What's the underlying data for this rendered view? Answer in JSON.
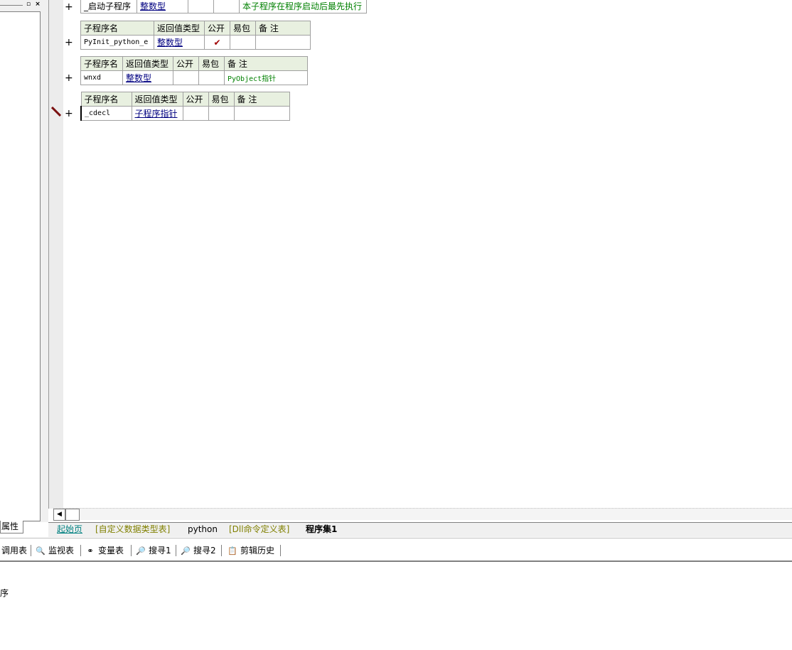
{
  "left_panel": {
    "tab_label": "属性",
    "pin_glyph": "▫",
    "close_glyph": "×"
  },
  "rows": [
    {
      "headers": null,
      "cells": [
        "_启动子程序",
        "整数型",
        "",
        "",
        "本子程序在程序启动后最先执行"
      ]
    },
    {
      "headers": [
        "子程序名",
        "返回值类型",
        "公开",
        "易包",
        "备 注"
      ],
      "cells": [
        "PyInit_python_e",
        "整数型",
        "✔",
        "",
        ""
      ]
    },
    {
      "headers": [
        "子程序名",
        "返回值类型",
        "公开",
        "易包",
        "备 注"
      ],
      "cells": [
        "wnxd",
        "整数型",
        "",
        "",
        "PyObject指针"
      ]
    },
    {
      "headers": [
        "子程序名",
        "返回值类型",
        "公开",
        "易包",
        "备 注"
      ],
      "cells": [
        "_cdecl",
        "子程序指针",
        "",
        "",
        ""
      ]
    }
  ],
  "plus_glyph": "+",
  "tabs": [
    "起始页",
    "[自定义数据类型表]",
    "python",
    "[Dll命令定义表]",
    "程序集1"
  ],
  "toolbar": [
    {
      "label": "调用表",
      "icon": "call-table-icon",
      "glyph": ""
    },
    {
      "label": "监视表",
      "icon": "magnifier-icon",
      "glyph": "🔍"
    },
    {
      "label": "变量表",
      "icon": "variables-icon",
      "glyph": "⚭"
    },
    {
      "label": "搜寻1",
      "icon": "search1-icon",
      "glyph": "🔎"
    },
    {
      "label": "搜寻2",
      "icon": "search2-icon",
      "glyph": "🔎"
    },
    {
      "label": "剪辑历史",
      "icon": "clip-history-icon",
      "glyph": "📋"
    }
  ],
  "output_text": "序",
  "colors": {
    "keyword_blue": "#000080",
    "comment_green": "#008000",
    "header_bg": "#e8f0e0"
  }
}
